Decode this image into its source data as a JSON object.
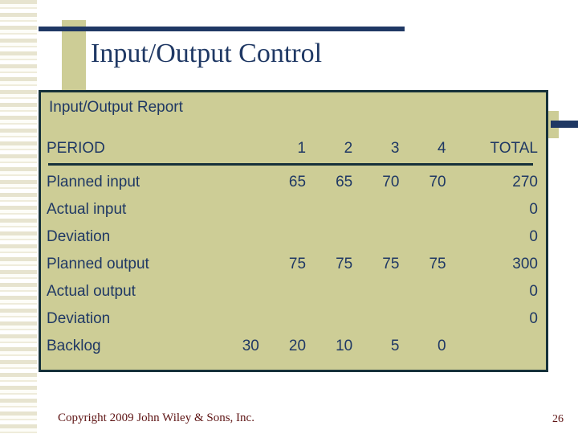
{
  "slide": {
    "title": "Input/Output Control",
    "report_heading": "Input/Output Report",
    "colors": {
      "title_navy": "#1f3864",
      "panel_tan": "#cdcd96",
      "panel_border": "#16313a",
      "footer_red": "#5e1414",
      "stripe_cream": "#e7e4cf"
    }
  },
  "table": {
    "columns": [
      "PERIOD",
      "",
      "1",
      "2",
      "3",
      "4",
      "",
      "TOTAL"
    ],
    "header": {
      "label": "PERIOD",
      "extra": "",
      "p1": "1",
      "p2": "2",
      "p3": "3",
      "p4": "4",
      "total": "TOTAL"
    },
    "rows": [
      {
        "label": "Planned input",
        "extra": "",
        "p1": "65",
        "p2": "65",
        "p3": "70",
        "p4": "70",
        "total": "270"
      },
      {
        "label": "Actual input",
        "extra": "",
        "p1": "",
        "p2": "",
        "p3": "",
        "p4": "",
        "total": "0"
      },
      {
        "label": "Deviation",
        "extra": "",
        "p1": "",
        "p2": "",
        "p3": "",
        "p4": "",
        "total": "0"
      },
      {
        "label": "Planned output",
        "extra": "",
        "p1": "75",
        "p2": "75",
        "p3": "75",
        "p4": "75",
        "total": "300"
      },
      {
        "label": "Actual output",
        "extra": "",
        "p1": "",
        "p2": "",
        "p3": "",
        "p4": "",
        "total": "0"
      },
      {
        "label": "Deviation",
        "extra": "",
        "p1": "",
        "p2": "",
        "p3": "",
        "p4": "",
        "total": "0"
      },
      {
        "label": "Backlog",
        "extra": "30",
        "p1": "20",
        "p2": "10",
        "p3": "5",
        "p4": "0",
        "total": ""
      }
    ]
  },
  "footer": {
    "copyright": "Copyright 2009 John Wiley & Sons, Inc.",
    "page_number": "26"
  }
}
